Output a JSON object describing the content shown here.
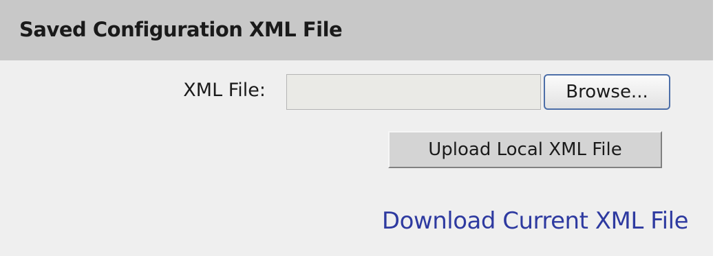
{
  "panel": {
    "title": "Saved Configuration XML File"
  },
  "form": {
    "file_label": "XML File:",
    "file_value": "",
    "browse_label": "Browse...",
    "upload_label": "Upload Local XML File"
  },
  "download": {
    "link_label": "Download Current XML File"
  },
  "colors": {
    "header_bg": "#c8c8c8",
    "panel_bg": "#efefef",
    "link": "#2e3aa0",
    "browse_border": "#4c6ea8"
  }
}
